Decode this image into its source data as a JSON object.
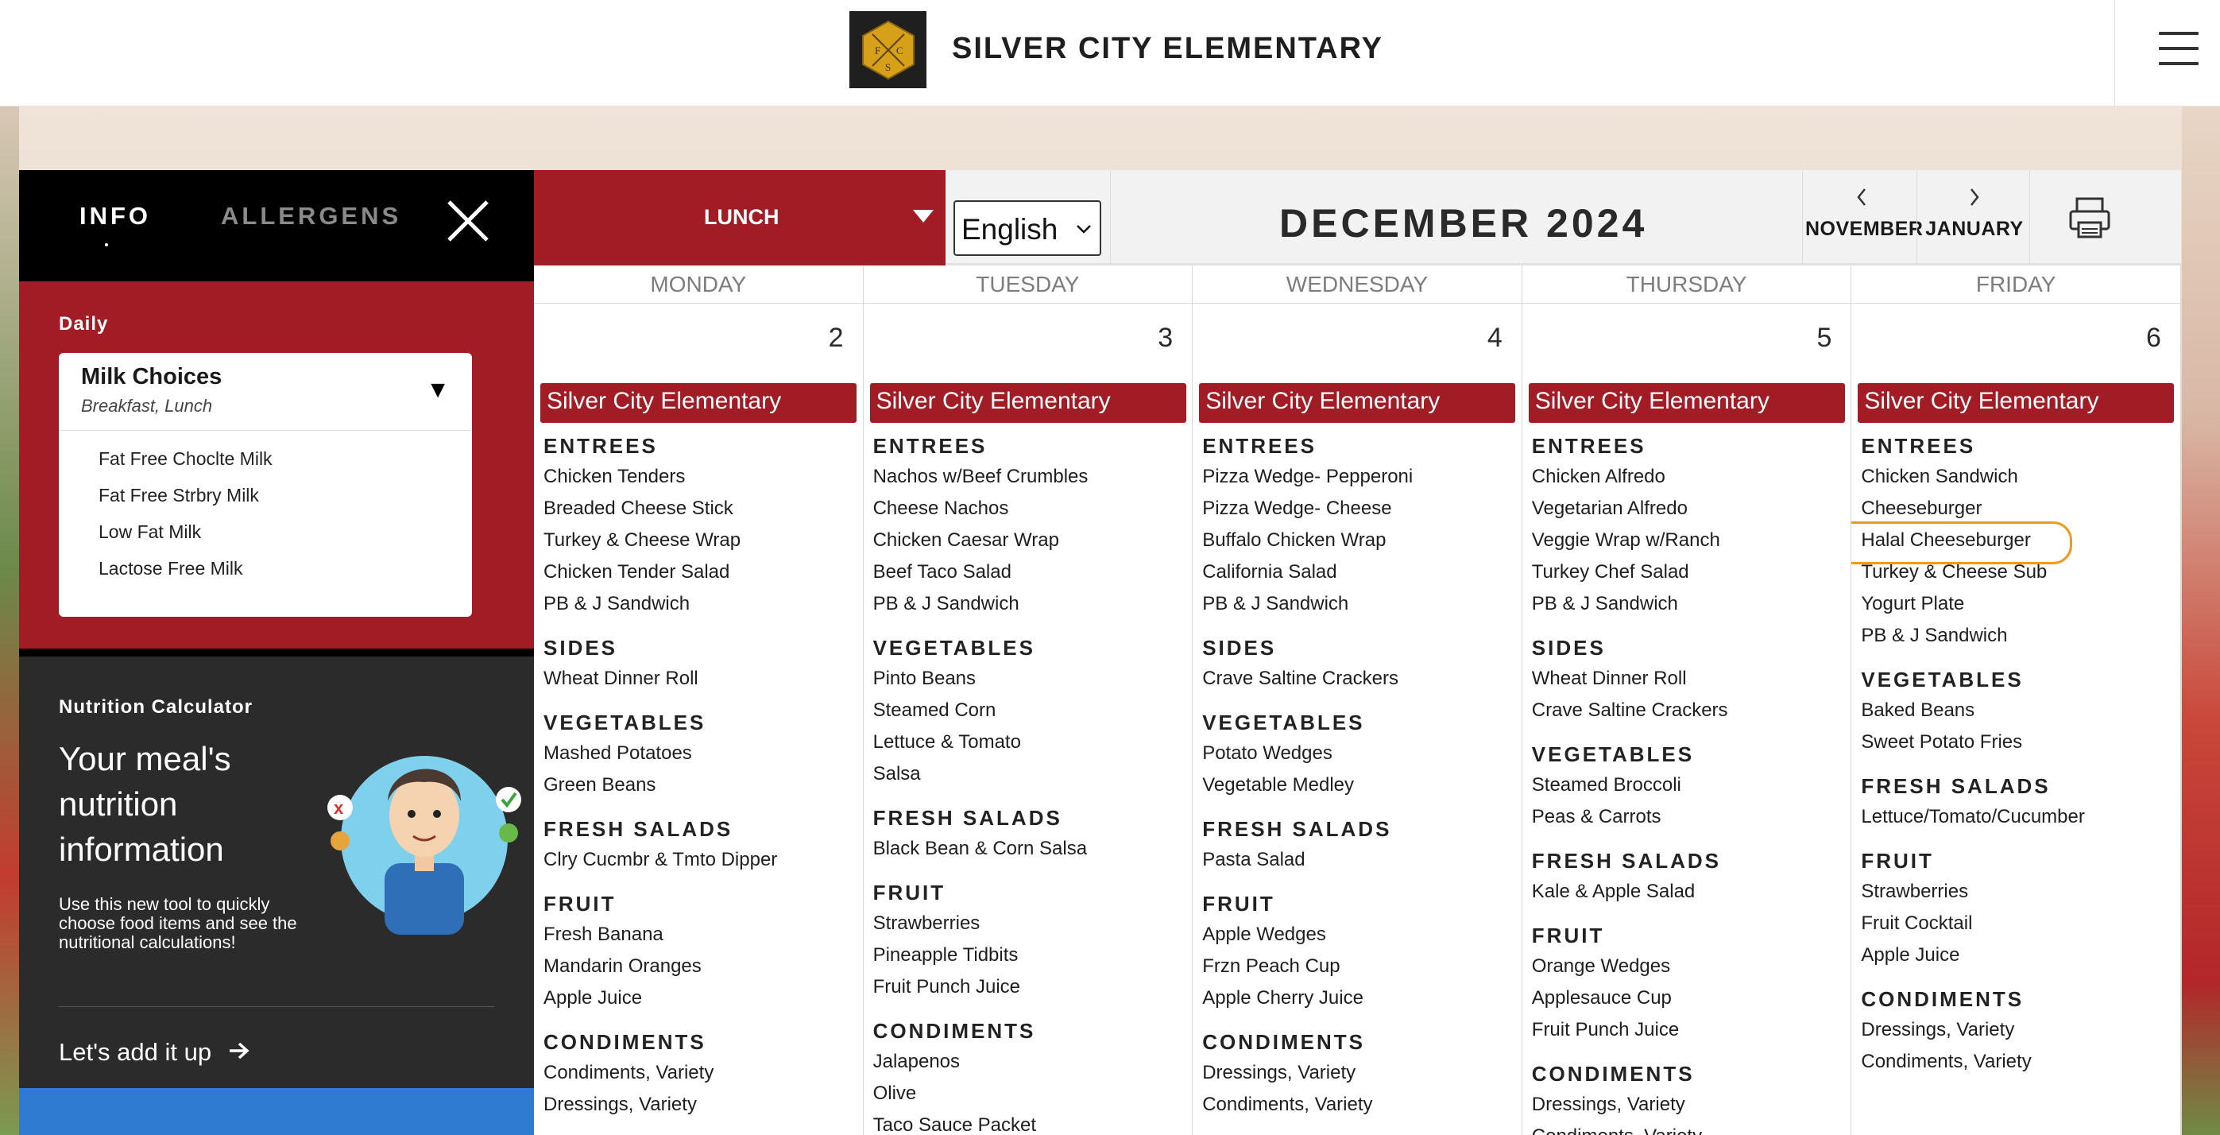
{
  "header": {
    "title": "SILVER CITY ELEMENTARY",
    "logo_letters": [
      "F",
      "C",
      "S"
    ],
    "menu_icon": "hamburger-icon"
  },
  "panel": {
    "tabs": [
      {
        "label": "INFO",
        "active": true
      },
      {
        "label": "ALLERGENS",
        "active": false
      }
    ],
    "daily": {
      "label": "Daily",
      "card_title": "Milk Choices",
      "card_subtitle": "Breakfast, Lunch",
      "items": [
        "Fat Free Choclte Milk",
        "Fat Free Strbry Milk",
        "Low Fat Milk",
        "Lactose Free Milk"
      ]
    },
    "calculator": {
      "label": "Nutrition Calculator",
      "headline": "Your meal's nutrition information",
      "description": "Use this new tool to quickly choose food items and see the nutritional calculations!",
      "link": "Let's add it up"
    }
  },
  "toolbar": {
    "meal": "LUNCH",
    "language": "English",
    "month": "DECEMBER 2024",
    "prev": "NOVEMBER",
    "next": "JANUARY"
  },
  "colors": {
    "brand_red": "#a21c25",
    "highlight": "#f09a1b",
    "accent_blue": "#2f7bd1"
  },
  "calendar": {
    "weekdays": [
      "MONDAY",
      "TUESDAY",
      "WEDNESDAY",
      "THURSDAY",
      "FRIDAY"
    ],
    "days": [
      {
        "date": "2",
        "school": "Silver City Elementary",
        "sections": [
          {
            "name": "ENTREES",
            "items": [
              "Chicken Tenders",
              "Breaded Cheese Stick",
              "Turkey & Cheese Wrap",
              "Chicken Tender Salad",
              "PB & J Sandwich"
            ]
          },
          {
            "name": "SIDES",
            "items": [
              "Wheat Dinner Roll"
            ]
          },
          {
            "name": "VEGETABLES",
            "items": [
              "Mashed Potatoes",
              "Green Beans"
            ]
          },
          {
            "name": "FRESH SALADS",
            "items": [
              "Clry Cucmbr & Tmto Dipper"
            ]
          },
          {
            "name": "FRUIT",
            "items": [
              "Fresh Banana",
              "Mandarin Oranges",
              "Apple Juice"
            ]
          },
          {
            "name": "CONDIMENTS",
            "items": [
              "Condiments, Variety",
              "Dressings, Variety"
            ]
          }
        ]
      },
      {
        "date": "3",
        "school": "Silver City Elementary",
        "sections": [
          {
            "name": "ENTREES",
            "items": [
              "Nachos w/Beef Crumbles",
              "Cheese Nachos",
              "Chicken Caesar Wrap",
              "Beef Taco Salad",
              "PB & J Sandwich"
            ]
          },
          {
            "name": "VEGETABLES",
            "items": [
              "Pinto Beans",
              "Steamed Corn",
              "Lettuce & Tomato",
              "Salsa"
            ]
          },
          {
            "name": "FRESH SALADS",
            "items": [
              "Black Bean & Corn Salsa"
            ]
          },
          {
            "name": "FRUIT",
            "items": [
              "Strawberries",
              "Pineapple Tidbits",
              "Fruit Punch Juice"
            ]
          },
          {
            "name": "CONDIMENTS",
            "items": [
              "Jalapenos",
              "Olive",
              "Taco Sauce Packet"
            ]
          }
        ]
      },
      {
        "date": "4",
        "school": "Silver City Elementary",
        "sections": [
          {
            "name": "ENTREES",
            "items": [
              "Pizza Wedge- Pepperoni",
              "Pizza Wedge- Cheese",
              "Buffalo Chicken Wrap",
              "California Salad",
              "PB & J Sandwich"
            ]
          },
          {
            "name": "SIDES",
            "items": [
              "Crave Saltine Crackers"
            ]
          },
          {
            "name": "VEGETABLES",
            "items": [
              "Potato Wedges",
              "Vegetable Medley"
            ]
          },
          {
            "name": "FRESH SALADS",
            "items": [
              "Pasta Salad"
            ]
          },
          {
            "name": "FRUIT",
            "items": [
              "Apple Wedges",
              "Frzn Peach Cup",
              "Apple Cherry Juice"
            ]
          },
          {
            "name": "CONDIMENTS",
            "items": [
              "Dressings, Variety",
              "Condiments, Variety"
            ]
          }
        ]
      },
      {
        "date": "5",
        "school": "Silver City Elementary",
        "sections": [
          {
            "name": "ENTREES",
            "items": [
              "Chicken Alfredo",
              "Vegetarian Alfredo",
              "Veggie Wrap w/Ranch",
              "Turkey Chef Salad",
              "PB & J Sandwich"
            ]
          },
          {
            "name": "SIDES",
            "items": [
              "Wheat Dinner Roll",
              "Crave Saltine Crackers"
            ]
          },
          {
            "name": "VEGETABLES",
            "items": [
              "Steamed Broccoli",
              "Peas & Carrots"
            ]
          },
          {
            "name": "FRESH SALADS",
            "items": [
              "Kale & Apple Salad"
            ]
          },
          {
            "name": "FRUIT",
            "items": [
              "Orange Wedges",
              "Applesauce Cup",
              "Fruit Punch Juice"
            ]
          },
          {
            "name": "CONDIMENTS",
            "items": [
              "Dressings, Variety",
              "Condiments, Variety"
            ]
          }
        ]
      },
      {
        "date": "6",
        "school": "Silver City Elementary",
        "highlighted_item": "Halal Cheeseburger",
        "sections": [
          {
            "name": "ENTREES",
            "items": [
              "Chicken Sandwich",
              "Cheeseburger",
              "Halal Cheeseburger",
              "Turkey & Cheese Sub",
              "Yogurt Plate",
              "PB & J Sandwich"
            ]
          },
          {
            "name": "VEGETABLES",
            "items": [
              "Baked Beans",
              "Sweet Potato Fries"
            ]
          },
          {
            "name": "FRESH SALADS",
            "items": [
              "Lettuce/Tomato/Cucumber"
            ]
          },
          {
            "name": "FRUIT",
            "items": [
              "Strawberries",
              "Fruit Cocktail",
              "Apple Juice"
            ]
          },
          {
            "name": "CONDIMENTS",
            "items": [
              "Dressings, Variety",
              "Condiments, Variety"
            ]
          }
        ]
      }
    ]
  }
}
